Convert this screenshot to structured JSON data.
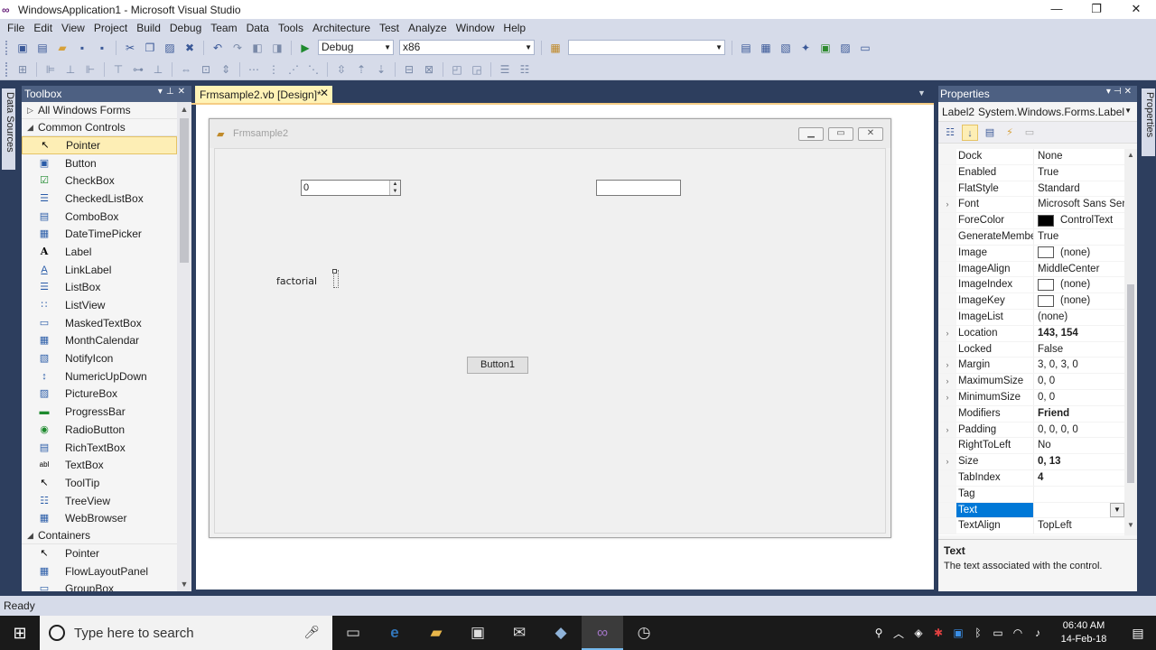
{
  "window": {
    "title": "WindowsApplication1 - Microsoft Visual Studio",
    "controls": {
      "minimize": "—",
      "maximize": "❐",
      "close": "✕"
    }
  },
  "menu": [
    "File",
    "Edit",
    "View",
    "Project",
    "Build",
    "Debug",
    "Team",
    "Data",
    "Tools",
    "Architecture",
    "Test",
    "Analyze",
    "Window",
    "Help"
  ],
  "toolbar": {
    "config": "Debug",
    "platform": "x86",
    "find": ""
  },
  "left_strip": {
    "data_sources": "Data Sources"
  },
  "toolbox": {
    "title": "Toolbox",
    "groups": [
      {
        "label": "All Windows Forms",
        "expanded": false
      },
      {
        "label": "Common Controls",
        "expanded": true
      },
      {
        "label": "Containers",
        "expanded": true
      }
    ],
    "common_controls": [
      {
        "label": "Pointer",
        "icon": "↖",
        "selected": true
      },
      {
        "label": "Button",
        "icon": "▣"
      },
      {
        "label": "CheckBox",
        "icon": "☑"
      },
      {
        "label": "CheckedListBox",
        "icon": "☰"
      },
      {
        "label": "ComboBox",
        "icon": "▤"
      },
      {
        "label": "DateTimePicker",
        "icon": "▦"
      },
      {
        "label": "Label",
        "icon": "A"
      },
      {
        "label": "LinkLabel",
        "icon": "A"
      },
      {
        "label": "ListBox",
        "icon": "☰"
      },
      {
        "label": "ListView",
        "icon": "∷"
      },
      {
        "label": "MaskedTextBox",
        "icon": "▭"
      },
      {
        "label": "MonthCalendar",
        "icon": "▦"
      },
      {
        "label": "NotifyIcon",
        "icon": "▧"
      },
      {
        "label": "NumericUpDown",
        "icon": "↕"
      },
      {
        "label": "PictureBox",
        "icon": "▨"
      },
      {
        "label": "ProgressBar",
        "icon": "▬"
      },
      {
        "label": "RadioButton",
        "icon": "◉"
      },
      {
        "label": "RichTextBox",
        "icon": "▤"
      },
      {
        "label": "TextBox",
        "icon": "abl"
      },
      {
        "label": "ToolTip",
        "icon": "↖"
      },
      {
        "label": "TreeView",
        "icon": "☷"
      },
      {
        "label": "WebBrowser",
        "icon": "▦"
      }
    ],
    "containers": [
      {
        "label": "Pointer",
        "icon": "↖"
      },
      {
        "label": "FlowLayoutPanel",
        "icon": "▦"
      },
      {
        "label": "GroupBox",
        "icon": "▭"
      }
    ]
  },
  "document_tab": {
    "label": "Frmsample2.vb [Design]*"
  },
  "form": {
    "title": "Frmsample2",
    "numeric_value": "0",
    "factorial_label": "factorial",
    "button_label": "Button1"
  },
  "properties": {
    "title": "Properties",
    "object_name": "Label2",
    "object_type": "System.Windows.Forms.Label",
    "rows": [
      {
        "name": "Dock",
        "value": "None",
        "expand": false,
        "bold": false
      },
      {
        "name": "Enabled",
        "value": "True",
        "expand": false,
        "bold": false
      },
      {
        "name": "FlatStyle",
        "value": "Standard",
        "expand": false,
        "bold": false
      },
      {
        "name": "Font",
        "value": "Microsoft Sans Seri",
        "expand": true,
        "bold": false
      },
      {
        "name": "ForeColor",
        "value": "ControlText",
        "expand": false,
        "bold": false,
        "swatch": "black"
      },
      {
        "name": "GenerateMembe",
        "value": "True",
        "expand": false,
        "bold": false
      },
      {
        "name": "Image",
        "value": "(none)",
        "expand": false,
        "bold": false,
        "swatch": "white"
      },
      {
        "name": "ImageAlign",
        "value": "MiddleCenter",
        "expand": false,
        "bold": false
      },
      {
        "name": "ImageIndex",
        "value": "(none)",
        "expand": false,
        "bold": false,
        "swatch": "white"
      },
      {
        "name": "ImageKey",
        "value": "(none)",
        "expand": false,
        "bold": false,
        "swatch": "white"
      },
      {
        "name": "ImageList",
        "value": "(none)",
        "expand": false,
        "bold": false
      },
      {
        "name": "Location",
        "value": "143, 154",
        "expand": true,
        "bold": true
      },
      {
        "name": "Locked",
        "value": "False",
        "expand": false,
        "bold": false
      },
      {
        "name": "Margin",
        "value": "3, 0, 3, 0",
        "expand": true,
        "bold": false
      },
      {
        "name": "MaximumSize",
        "value": "0, 0",
        "expand": true,
        "bold": false
      },
      {
        "name": "MinimumSize",
        "value": "0, 0",
        "expand": true,
        "bold": false
      },
      {
        "name": "Modifiers",
        "value": "Friend",
        "expand": false,
        "bold": true
      },
      {
        "name": "Padding",
        "value": "0, 0, 0, 0",
        "expand": true,
        "bold": false
      },
      {
        "name": "RightToLeft",
        "value": "No",
        "expand": false,
        "bold": false
      },
      {
        "name": "Size",
        "value": "0, 13",
        "expand": true,
        "bold": true
      },
      {
        "name": "TabIndex",
        "value": "4",
        "expand": false,
        "bold": true
      },
      {
        "name": "Tag",
        "value": "",
        "expand": false,
        "bold": false
      },
      {
        "name": "Text",
        "value": "",
        "expand": false,
        "bold": false,
        "selected": true
      },
      {
        "name": "TextAlign",
        "value": "TopLeft",
        "expand": false,
        "bold": false
      }
    ],
    "description_title": "Text",
    "description_text": "The text associated with the control."
  },
  "right_strip": {
    "properties": "Properties"
  },
  "status": {
    "text": "Ready"
  },
  "taskbar": {
    "search_placeholder": "Type here to search",
    "time": "06:40 AM",
    "date": "14-Feb-18"
  },
  "colors": {
    "ide_frame": "#2d3e5e",
    "chrome": "#d6dbe9",
    "panel_header": "#4d6082",
    "selection_blue": "#0078d7",
    "tab_yellow": "#fff3b6"
  }
}
